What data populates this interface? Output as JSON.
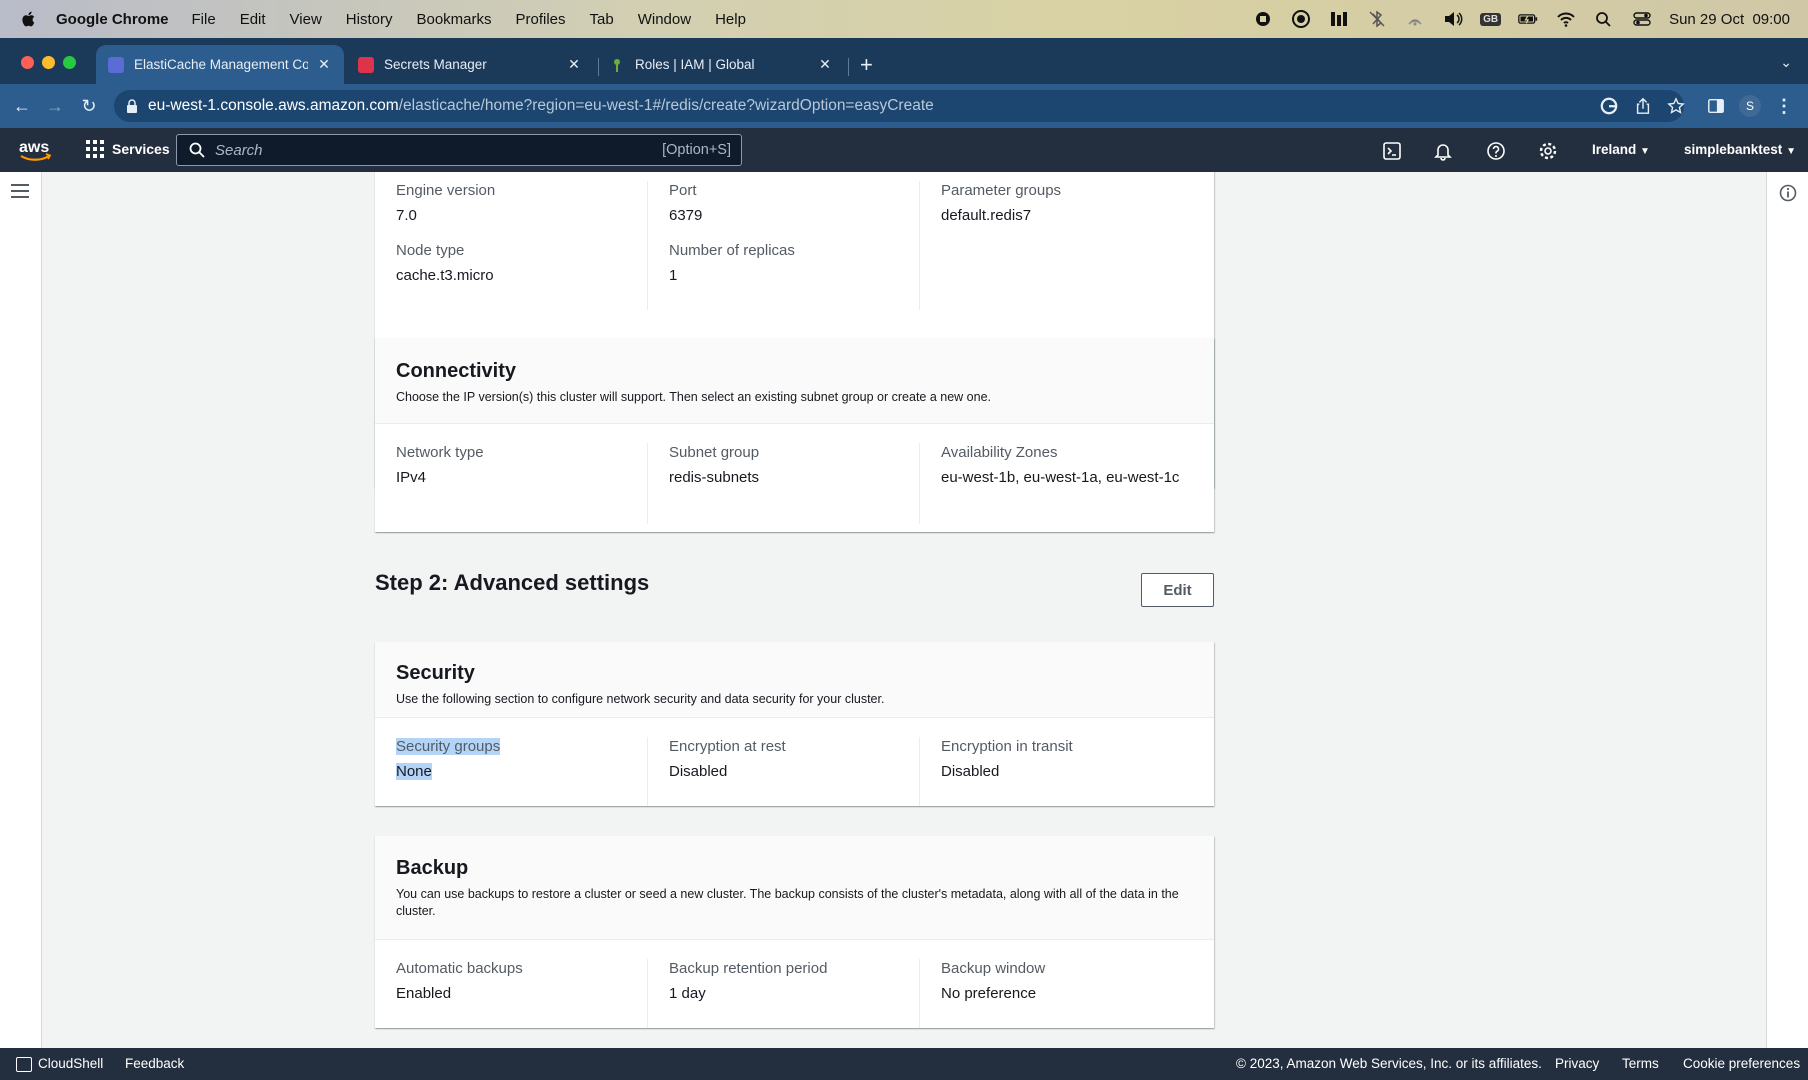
{
  "menubar": {
    "app_name": "Google Chrome",
    "menus": [
      "File",
      "Edit",
      "View",
      "History",
      "Bookmarks",
      "Profiles",
      "Tab",
      "Window",
      "Help"
    ],
    "keyboard_badge": "GB",
    "datetime": "Sun 29 Oct  09:00"
  },
  "tabs": [
    {
      "title": "ElastiCache Management Con",
      "favicon_color": "#5a6cd6",
      "active": true
    },
    {
      "title": "Secrets Manager",
      "favicon_color": "#dd344c",
      "active": false
    },
    {
      "title": "Roles | IAM | Global",
      "favicon_color": "#6bae3f",
      "active": false
    }
  ],
  "address": {
    "host": "eu-west-1.console.aws.amazon.com",
    "path": "/elasticache/home?region=eu-west-1#/redis/create?wizardOption=easyCreate"
  },
  "profile_initial": "S",
  "aws": {
    "services_label": "Services",
    "search_placeholder": "Search",
    "search_shortcut": "[Option+S]",
    "region": "Ireland",
    "account": "simplebanktest"
  },
  "cluster_settings": {
    "row1": [
      {
        "label": "Engine version",
        "value": "7.0"
      },
      {
        "label": "Port",
        "value": "6379"
      },
      {
        "label": "Parameter groups",
        "value": "default.redis7"
      }
    ],
    "row2": [
      {
        "label": "Node type",
        "value": "cache.t3.micro"
      },
      {
        "label": "Number of replicas",
        "value": "1"
      }
    ]
  },
  "connectivity": {
    "title": "Connectivity",
    "description": "Choose the IP version(s) this cluster will support. Then select an existing subnet group or create a new one.",
    "fields": [
      {
        "label": "Network type",
        "value": "IPv4"
      },
      {
        "label": "Subnet group",
        "value": "redis-subnets"
      },
      {
        "label": "Availability Zones",
        "value": "eu-west-1b, eu-west-1a, eu-west-1c"
      }
    ]
  },
  "step2": {
    "title": "Step 2: Advanced settings",
    "edit_label": "Edit"
  },
  "security": {
    "title": "Security",
    "description": "Use the following section to configure network security and data security for your cluster.",
    "fields": [
      {
        "label": "Security groups",
        "value": "None"
      },
      {
        "label": "Encryption at rest",
        "value": "Disabled"
      },
      {
        "label": "Encryption in transit",
        "value": "Disabled"
      }
    ]
  },
  "backup": {
    "title": "Backup",
    "description": "You can use backups to restore a cluster or seed a new cluster. The backup consists of the cluster's metadata, along with all of the data in the cluster.",
    "fields": [
      {
        "label": "Automatic backups",
        "value": "Enabled"
      },
      {
        "label": "Backup retention period",
        "value": "1 day"
      },
      {
        "label": "Backup window",
        "value": "No preference"
      }
    ]
  },
  "footer": {
    "cloudshell": "CloudShell",
    "feedback": "Feedback",
    "copyright": "© 2023, Amazon Web Services, Inc. or its affiliates.",
    "privacy": "Privacy",
    "terms": "Terms",
    "cookies": "Cookie preferences"
  }
}
